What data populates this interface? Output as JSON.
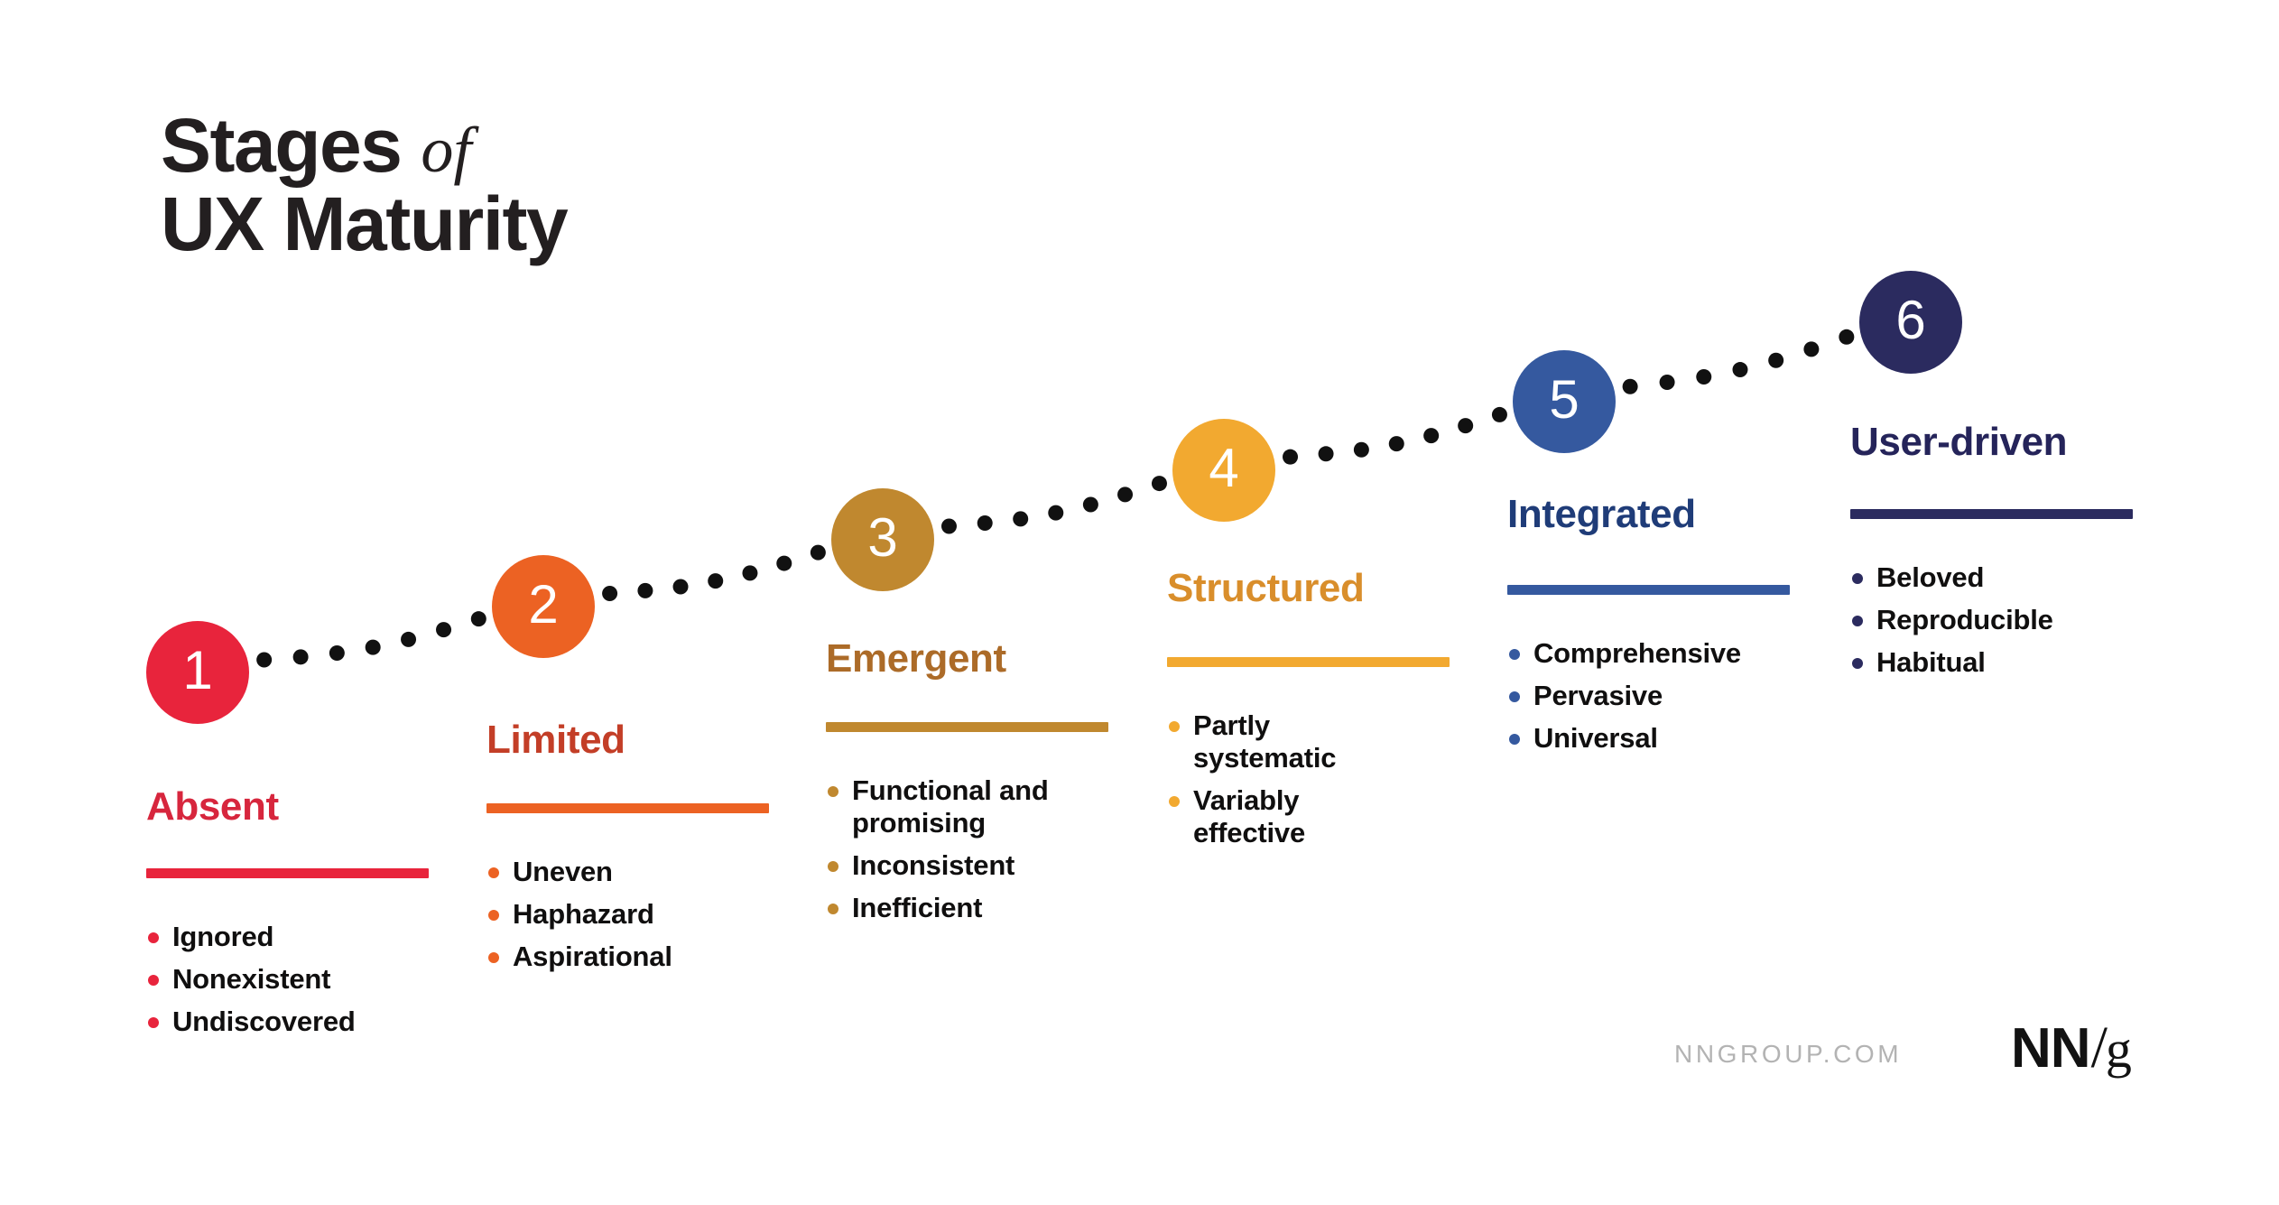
{
  "title": {
    "line1_main": "Stages",
    "line1_italic": "of",
    "line2": "UX Maturity"
  },
  "footer": {
    "url": "NNGROUP.COM",
    "logo_nn": "NN",
    "logo_slash": "/",
    "logo_g": "g"
  },
  "chart_data": {
    "type": "diagram",
    "title": "Stages of UX Maturity",
    "description": "Six ascending stages connected by a dotted rising path",
    "stages": [
      {
        "number": "1",
        "name": "Absent",
        "color": "#E8243C",
        "heading_color": "#D7263D",
        "bullets": [
          "Ignored",
          "Nonexistent",
          "Undiscovered"
        ]
      },
      {
        "number": "2",
        "name": "Limited",
        "color": "#EC6223",
        "heading_color": "#C33E27",
        "bullets": [
          "Uneven",
          "Haphazard",
          "Aspirational"
        ]
      },
      {
        "number": "3",
        "name": "Emergent",
        "color": "#C0882F",
        "heading_color": "#AC6B28",
        "bullets": [
          "Functional and promising",
          "Inconsistent",
          "Inefficient"
        ]
      },
      {
        "number": "4",
        "name": "Structured",
        "color": "#F2A930",
        "heading_color": "#D98E2B",
        "bullets": [
          "Partly systematic",
          "Variably effective"
        ]
      },
      {
        "number": "5",
        "name": "Integrated",
        "color": "#35599F",
        "heading_color": "#1F3C78",
        "bullets": [
          "Comprehensive",
          "Pervasive",
          "Universal"
        ]
      },
      {
        "number": "6",
        "name": "User-driven",
        "color": "#2B2B5F",
        "heading_color": "#25245A",
        "bullets": [
          "Beloved",
          "Reproducible",
          "Habitual"
        ]
      }
    ]
  }
}
